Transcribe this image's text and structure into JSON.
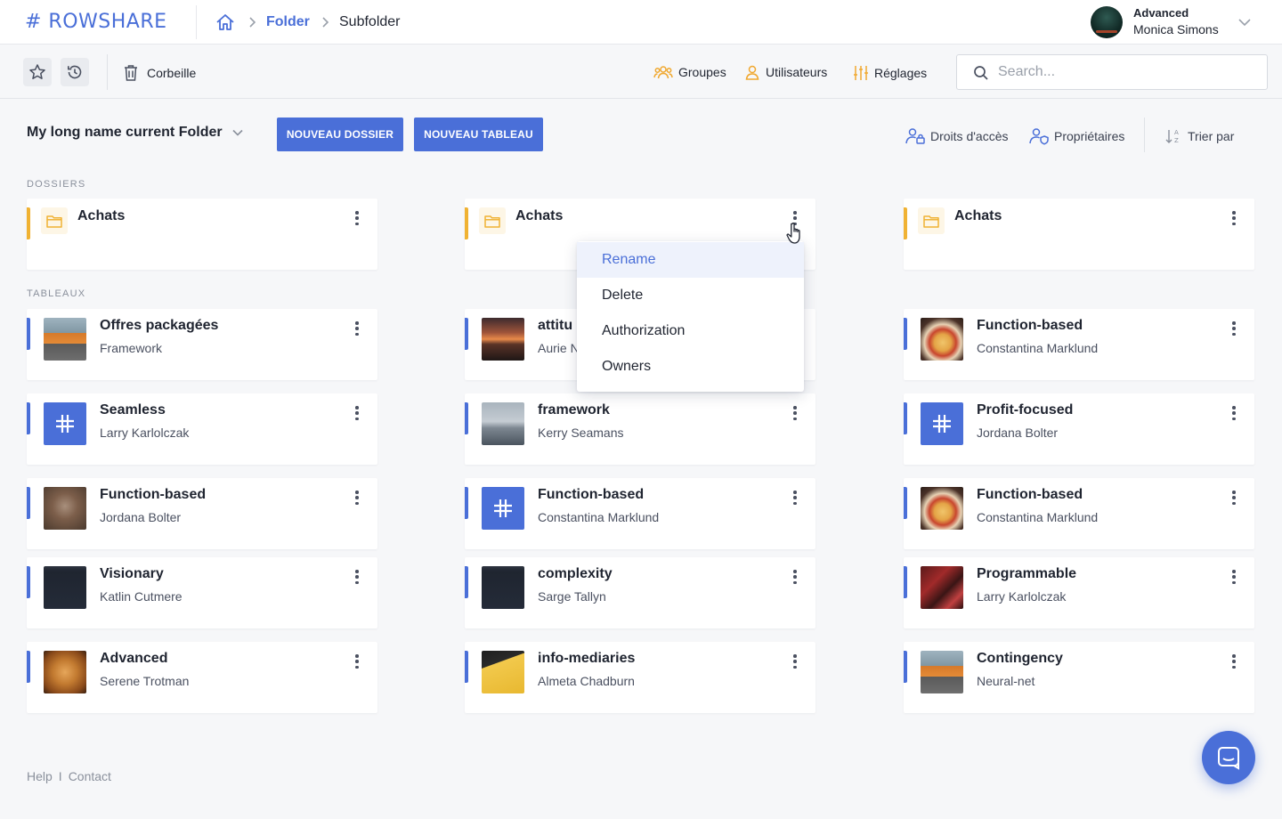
{
  "brand": {
    "logo_text": "# ROWSHARE",
    "accent": "#4a6fd8",
    "folder_accent": "#f0b233"
  },
  "breadcrumb": {
    "home_icon": "home-icon",
    "folder": "Folder",
    "subfolder": "Subfolder"
  },
  "user": {
    "plan": "Advanced",
    "name": "Monica Simons"
  },
  "toolbar": {
    "trash": "Corbeille",
    "groups": "Groupes",
    "users": "Utilisateurs",
    "settings": "Réglages",
    "search_placeholder": "Search..."
  },
  "header": {
    "folder_name": "My long name current Folder",
    "new_folder": "NOUVEAU DOSSIER",
    "new_table": "NOUVEAU TABLEAU",
    "access_rights": "Droits d'accès",
    "owners": "Propriétaires",
    "sort_by": "Trier par"
  },
  "sections": {
    "folders": "DOSSIERS",
    "tables": "TABLEAUX"
  },
  "folders": [
    {
      "title": "Achats"
    },
    {
      "title": "Achats"
    },
    {
      "title": "Achats"
    }
  ],
  "tables": [
    {
      "title": "Offres packagées",
      "owner": "Framework",
      "thumb": "car"
    },
    {
      "title": "attitu",
      "owner": "Aurie N",
      "thumb": "sunset"
    },
    {
      "title": "Function-based",
      "owner": "Constantina Marklund",
      "thumb": "pizza"
    },
    {
      "title": "Seamless",
      "owner": "Larry Karlolczak",
      "thumb": "hash"
    },
    {
      "title": "framework",
      "owner": "Kerry Seamans",
      "thumb": "flag"
    },
    {
      "title": "Profit-focused",
      "owner": "Jordana Bolter",
      "thumb": "hash"
    },
    {
      "title": "Function-based",
      "owner": "Jordana Bolter",
      "thumb": "sand"
    },
    {
      "title": "Function-based",
      "owner": "Constantina Marklund",
      "thumb": "hash"
    },
    {
      "title": "Function-based",
      "owner": "Constantina Marklund",
      "thumb": "pizza"
    },
    {
      "title": "Visionary",
      "owner": "Katlin Cutmere",
      "thumb": "dark"
    },
    {
      "title": "complexity",
      "owner": "Sarge Tallyn",
      "thumb": "dark"
    },
    {
      "title": "Programmable",
      "owner": "Larry Karlolczak",
      "thumb": "red"
    },
    {
      "title": "Advanced",
      "owner": "Serene Trotman",
      "thumb": "bread"
    },
    {
      "title": "info-mediaries",
      "owner": "Almeta Chadburn",
      "thumb": "yellow"
    },
    {
      "title": "Contingency",
      "owner": "Neural-net",
      "thumb": "car"
    }
  ],
  "context_menu": {
    "items": [
      {
        "label": "Rename",
        "active": true
      },
      {
        "label": "Delete"
      },
      {
        "label": "Authorization"
      },
      {
        "label": "Owners"
      }
    ]
  },
  "footer": {
    "help": "Help",
    "separator": "I",
    "contact": "Contact"
  }
}
